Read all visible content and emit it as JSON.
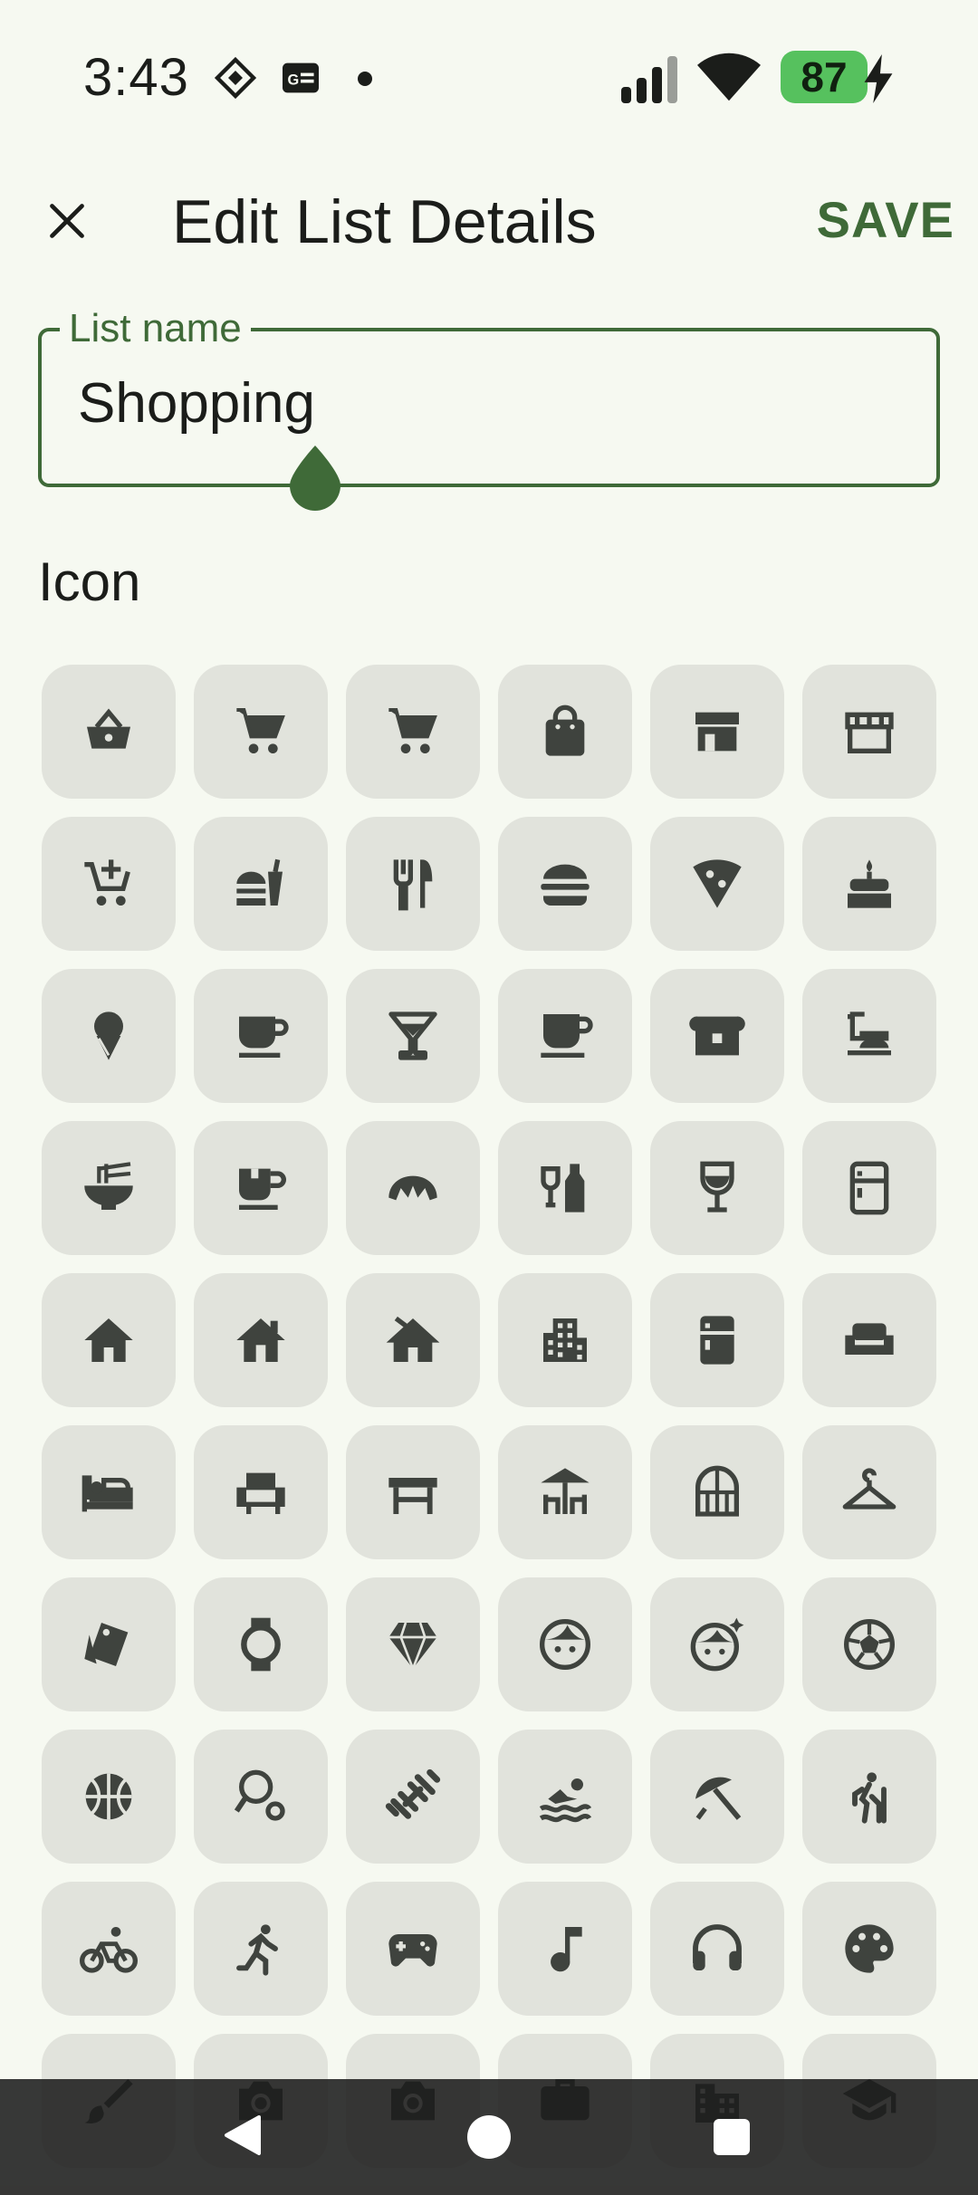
{
  "status_bar": {
    "time": "3:43",
    "battery_level": "87",
    "icons": [
      "launcher-icon",
      "news-icon",
      "dot-icon",
      "signal-icon",
      "wifi-icon",
      "battery-icon",
      "charging-icon"
    ]
  },
  "app_bar": {
    "title": "Edit List Details",
    "close_icon": "close-icon",
    "save_label": "SAVE"
  },
  "list_name_field": {
    "label": "List name",
    "value": "Shopping"
  },
  "icon_section": {
    "title": "Icon"
  },
  "icon_grid": [
    "basket",
    "cart",
    "cart-outline",
    "shopping-bag",
    "storefront",
    "storefront-outline",
    "add-shopping-cart",
    "fastfood",
    "restaurant",
    "lunch-dining",
    "local-pizza",
    "cake",
    "icecream",
    "coffee",
    "local-bar",
    "local-cafe",
    "bakery-dining",
    "room-service",
    "ramen-dining",
    "emoji-food-beverage",
    "croissant",
    "liquor",
    "wine-bar",
    "kitchen-outline",
    "home",
    "home-repair",
    "cottage",
    "apartment",
    "kitchen",
    "weekend",
    "bed",
    "chair",
    "table-restaurant",
    "deck",
    "door-front",
    "checkroom",
    "style",
    "watch",
    "diamond",
    "face",
    "face-sparkle",
    "soccer",
    "basketball",
    "tennis",
    "fitness",
    "pool",
    "beach-access",
    "hiking",
    "bike",
    "directions-run",
    "videogame",
    "music-note",
    "headphones",
    "palette",
    "brush",
    "camera",
    "photo-camera",
    "work",
    "location-city",
    "school"
  ],
  "colors": {
    "background": "#f6f9f1",
    "accent": "#3f6a38",
    "tile": "#e1e3dc",
    "icon": "#3f433e"
  }
}
